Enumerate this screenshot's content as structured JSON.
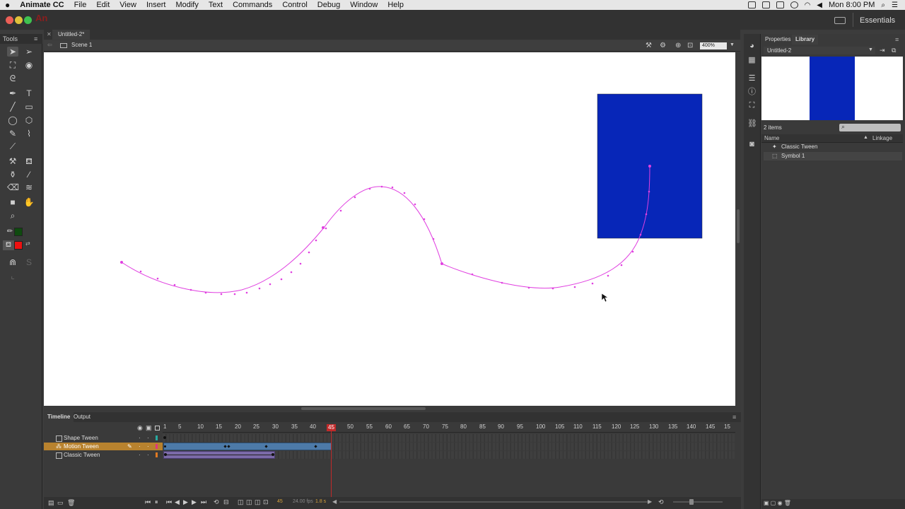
{
  "menubar": {
    "apple": "",
    "app": "Animate CC",
    "items": [
      "File",
      "Edit",
      "View",
      "Insert",
      "Modify",
      "Text",
      "Commands",
      "Control",
      "Debug",
      "Window",
      "Help"
    ],
    "clock": "Mon 8:00 PM"
  },
  "appbar": {
    "logo": "An",
    "workspace": "Essentials"
  },
  "tools": {
    "header": "Tools"
  },
  "document": {
    "tab": "Untitled-2*",
    "scene": "Scene 1",
    "zoom": "400%"
  },
  "stage": {
    "background": "#ffffff",
    "symbol_color": "#0726b8",
    "path_color": "#e040e0"
  },
  "timeline": {
    "tabs": [
      "Timeline",
      "Output"
    ],
    "ruler": [
      "1",
      "5",
      "10",
      "15",
      "20",
      "25",
      "30",
      "35",
      "40",
      "45",
      "50",
      "55",
      "60",
      "65",
      "70",
      "75",
      "80",
      "85",
      "90",
      "95",
      "100",
      "105",
      "110",
      "115",
      "120",
      "125",
      "130",
      "135",
      "140",
      "145",
      "15"
    ],
    "current_frame": "45",
    "layers": [
      {
        "name": "Shape Tween",
        "color": "#28a9a0"
      },
      {
        "name": "Motion Tween",
        "color": "#e0367e",
        "selected": true
      },
      {
        "name": "Classic Tween",
        "color": "#e07a22"
      }
    ],
    "status": {
      "frame": "45",
      "fps": "24.00 fps",
      "time": "1.8 s"
    }
  },
  "library": {
    "tabs": [
      "Properties",
      "Library"
    ],
    "document": "Untitled-2",
    "count": "2 items",
    "columns": {
      "name": "Name",
      "linkage": "Linkage"
    },
    "items": [
      "Classic Tween",
      "Symbol 1"
    ]
  }
}
